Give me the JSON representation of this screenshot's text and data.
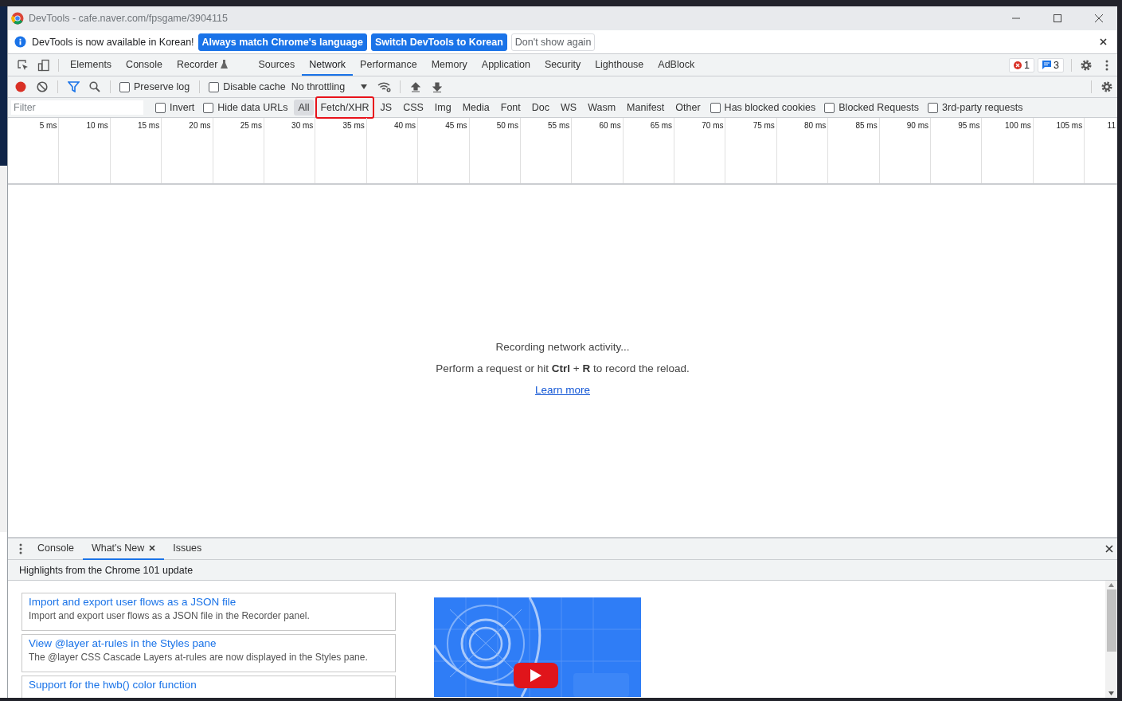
{
  "window": {
    "title": "DevTools - cafe.naver.com/fpsgame/3904115"
  },
  "infobar": {
    "message": "DevTools is now available in Korean!",
    "buttons": [
      {
        "label": "Always match Chrome's language",
        "primary": true
      },
      {
        "label": "Switch DevTools to Korean",
        "primary": true
      },
      {
        "label": "Don't show again",
        "primary": false
      }
    ]
  },
  "panel_tabs": [
    {
      "label": "Elements",
      "selected": false,
      "experimental": false
    },
    {
      "label": "Console",
      "selected": false,
      "experimental": false
    },
    {
      "label": "Recorder",
      "selected": false,
      "experimental": true
    },
    {
      "label": "Sources",
      "selected": false,
      "experimental": false
    },
    {
      "label": "Network",
      "selected": true,
      "experimental": false
    },
    {
      "label": "Performance",
      "selected": false,
      "experimental": false
    },
    {
      "label": "Memory",
      "selected": false,
      "experimental": false
    },
    {
      "label": "Application",
      "selected": false,
      "experimental": false
    },
    {
      "label": "Security",
      "selected": false,
      "experimental": false
    },
    {
      "label": "Lighthouse",
      "selected": false,
      "experimental": false
    },
    {
      "label": "AdBlock",
      "selected": false,
      "experimental": false
    }
  ],
  "badges": {
    "errors": "1",
    "messages": "3"
  },
  "toolbar": {
    "recording": true,
    "checkboxes": [
      {
        "label": "Preserve log",
        "checked": false
      },
      {
        "label": "Disable cache",
        "checked": false
      }
    ],
    "throttling": "No throttling"
  },
  "filter": {
    "placeholder": "Filter",
    "checkboxes": [
      {
        "label": "Invert",
        "checked": false
      },
      {
        "label": "Hide data URLs",
        "checked": false
      }
    ],
    "types": [
      {
        "label": "All",
        "selected": true,
        "highlighted": false
      },
      {
        "label": "Fetch/XHR",
        "selected": false,
        "highlighted": true
      },
      {
        "label": "JS",
        "selected": false,
        "highlighted": false
      },
      {
        "label": "CSS",
        "selected": false,
        "highlighted": false
      },
      {
        "label": "Img",
        "selected": false,
        "highlighted": false
      },
      {
        "label": "Media",
        "selected": false,
        "highlighted": false
      },
      {
        "label": "Font",
        "selected": false,
        "highlighted": false
      },
      {
        "label": "Doc",
        "selected": false,
        "highlighted": false
      },
      {
        "label": "WS",
        "selected": false,
        "highlighted": false
      },
      {
        "label": "Wasm",
        "selected": false,
        "highlighted": false
      },
      {
        "label": "Manifest",
        "selected": false,
        "highlighted": false
      },
      {
        "label": "Other",
        "selected": false,
        "highlighted": false
      }
    ],
    "options": [
      {
        "label": "Has blocked cookies",
        "checked": false
      },
      {
        "label": "Blocked Requests",
        "checked": false
      },
      {
        "label": "3rd-party requests",
        "checked": false
      }
    ]
  },
  "timeline": {
    "ticks": [
      "5 ms",
      "10 ms",
      "15 ms",
      "20 ms",
      "25 ms",
      "30 ms",
      "35 ms",
      "40 ms",
      "45 ms",
      "50 ms",
      "55 ms",
      "60 ms",
      "65 ms",
      "70 ms",
      "75 ms",
      "80 ms",
      "85 ms",
      "90 ms",
      "95 ms",
      "100 ms",
      "105 ms",
      "11"
    ]
  },
  "empty_state": {
    "title": "Recording network activity...",
    "hint": "Perform a request or hit **Ctrl** + **R** to record the reload.",
    "link": "Learn more"
  },
  "drawer": {
    "tabs": [
      {
        "label": "Console",
        "selected": false,
        "closable": false
      },
      {
        "label": "What's New",
        "selected": true,
        "closable": true
      },
      {
        "label": "Issues",
        "selected": false,
        "closable": false
      }
    ],
    "header": "Highlights from the Chrome 101 update",
    "features": [
      {
        "title": "Import and export user flows as a JSON file",
        "description": "Import and export user flows as a JSON file in the Recorder panel."
      },
      {
        "title": "View @layer at-rules in the Styles pane",
        "description": "The @layer CSS Cascade Layers at-rules are now displayed in the Styles pane."
      },
      {
        "title": "Support for the hwb() color function"
      }
    ]
  }
}
